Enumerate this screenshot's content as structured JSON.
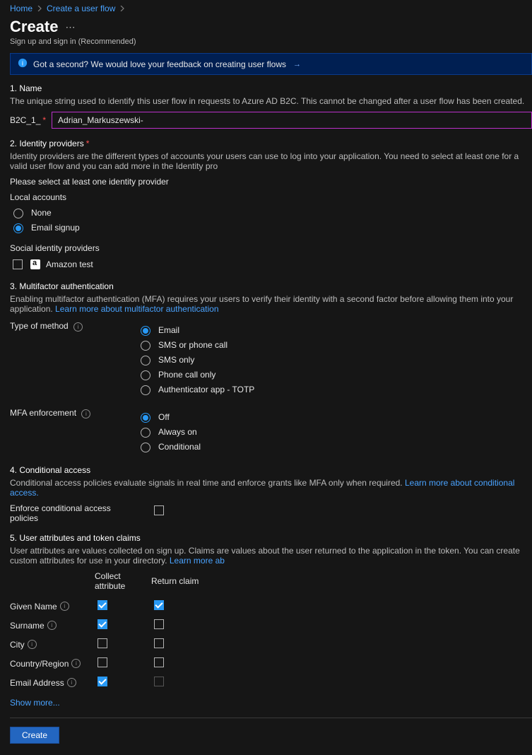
{
  "breadcrumb": {
    "home": "Home",
    "createFlow": "Create a user flow"
  },
  "title": "Create",
  "subtitle": "Sign up and sign in (Recommended)",
  "banner": {
    "text": "Got a second? We would love your feedback on creating user flows",
    "arrow": "→"
  },
  "sections": {
    "name": {
      "title": "1. Name",
      "desc": "The unique string used to identify this user flow in requests to Azure AD B2C. This cannot be changed after a user flow has been created.",
      "prefix": "B2C_1_",
      "value": "Adrian_Markuszewski-"
    },
    "idp": {
      "title": "2. Identity providers",
      "desc": "Identity providers are the different types of accounts your users can use to log into your application. You need to select at least one for a valid user flow and you can add more in the Identity pro",
      "hint": "Please select at least one identity provider",
      "localTitle": "Local accounts",
      "options": {
        "none": "None",
        "email": "Email signup"
      },
      "socialTitle": "Social identity providers",
      "social": {
        "amazon": "Amazon test"
      }
    },
    "mfa": {
      "title": "3. Multifactor authentication",
      "desc": "Enabling multifactor authentication (MFA) requires your users to verify their identity with a second factor before allowing them into your application. ",
      "learn": "Learn more about multifactor authentication",
      "methodLabel": "Type of method",
      "methods": {
        "email": "Email",
        "sms": "SMS or phone call",
        "smsonly": "SMS only",
        "phoneonly": "Phone call only",
        "totp": "Authenticator app - TOTP"
      },
      "enforceLabel": "MFA enforcement",
      "enforce": {
        "off": "Off",
        "always": "Always on",
        "cond": "Conditional"
      }
    },
    "ca": {
      "title": "4. Conditional access",
      "desc": "Conditional access policies evaluate signals in real time and enforce grants like MFA only when required. ",
      "learn": "Learn more about conditional access.",
      "enforceLabel": "Enforce conditional access policies"
    },
    "attrs": {
      "title": "5. User attributes and token claims",
      "desc": "User attributes are values collected on sign up. Claims are values about the user returned to the application in the token. You can create custom attributes for use in your directory. ",
      "learn": "Learn more ab",
      "col1": "Collect attribute",
      "col2": "Return claim",
      "rows": {
        "given": "Given Name",
        "surname": "Surname",
        "city": "City",
        "country": "Country/Region",
        "email": "Email Address"
      },
      "showMore": "Show more..."
    }
  },
  "footer": {
    "create": "Create"
  }
}
